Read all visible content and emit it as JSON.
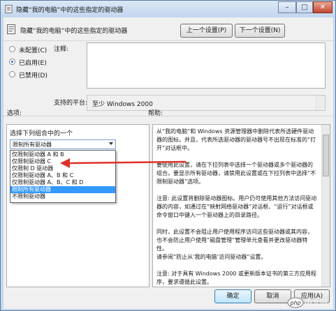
{
  "window": {
    "title": "隐藏“我的电脑”中的这些指定的驱动器",
    "minimize_glyph": "–",
    "maximize_glyph": "□",
    "close_glyph": "✕"
  },
  "header": {
    "policy_name": "隐藏“我的电脑”中的这些指定的驱动器",
    "prev_setting_label": "上一个设置(P)",
    "next_setting_label": "下一个设置(N)"
  },
  "state": {
    "options": [
      {
        "label": "未配置(C)",
        "selected": false
      },
      {
        "label": "已启用(E)",
        "selected": true
      },
      {
        "label": "已禁用(D)",
        "selected": false
      }
    ],
    "comment_label": "注释:",
    "comment_value": "",
    "supported_label": "支持的平台:",
    "supported_value": "至少 Windows 2000"
  },
  "options_panel": {
    "section_label": "选项:",
    "prompt": "选择下列组合中的一个",
    "combo_value": "限制所有驱动器",
    "dropdown_items": [
      {
        "label": "仅限制驱动器 A 和 B",
        "selected": false
      },
      {
        "label": "仅限制驱动器 C",
        "selected": false
      },
      {
        "label": "仅限制 D 驱动器",
        "selected": false
      },
      {
        "label": "仅限制驱动器 A、B 和 C",
        "selected": false
      },
      {
        "label": "仅限制驱动器 A、B、C 和 D",
        "selected": false
      },
      {
        "label": "限制所有驱动器",
        "selected": true
      },
      {
        "label": "不限制驱动器",
        "selected": false
      }
    ]
  },
  "help_panel": {
    "section_label": "帮助:",
    "paragraphs": [
      "从“我的电脑”和 Windows 资源管理器中删除代表所选硬件驱动器的图标。并且，代表所选驱动器的驱动器号不出现在标准的“打开”对话框中。",
      "要使用此设置，请在下拉列表中选择一个驱动器或多个驱动器的组合。要显示所有驱动器，请禁用此设置或在下拉列表中选择“不限制驱动器”选项。",
      "注意: 此设置将删除驱动器图标。用户仍可使用其他方法访问驱动器的内容，如通过在“映射网络驱动器”对话框、“运行”对话框或命令窗口中键入一个驱动器上的目录路径。",
      "同时，此设置不会阻止用户使用程序访问这些驱动器或其内容，也不会防止用户使用“磁盘管理”管理单元查看并更改驱动器特性。",
      "请参阅“防止从‘我的电脑’访问驱动器”设置。",
      "注意: 对于具有 Windows 2000 或更新版本证书的第三方应用程序，要求遵循此设置。"
    ]
  },
  "footer": {
    "ok_label": "确定",
    "cancel_label": "取消",
    "apply_label": "应用(A)"
  },
  "watermark": {
    "text": "php 中文网"
  },
  "colors": {
    "annotation_arrow": "#e0302a",
    "selection": "#3399ff"
  }
}
